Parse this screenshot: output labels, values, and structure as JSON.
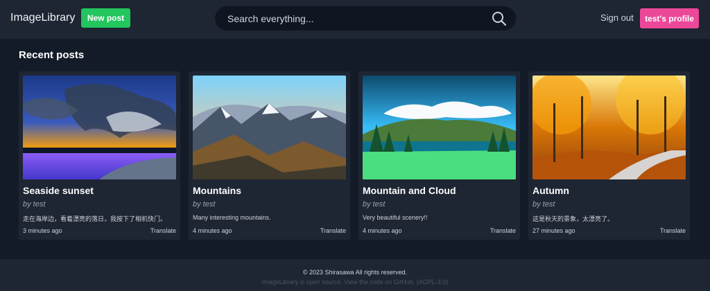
{
  "header": {
    "brand": "ImageLibrary",
    "new_post_label": "New post",
    "search_placeholder": "Search everything...",
    "signout_label": "Sign out",
    "profile_label": "test's profile",
    "colors": {
      "new_post": "#22c55e",
      "profile": "#ec4899"
    }
  },
  "main": {
    "section_title": "Recent posts",
    "posts": [
      {
        "title": "Seaside sunset",
        "author": "by test",
        "description": "走在海岸边，看着漂亮的落日，我按下了相机快门。",
        "time": "3 minutes ago",
        "translate": "Translate"
      },
      {
        "title": "Mountains",
        "author": "by test",
        "description": "Many interesting mountains.",
        "time": "4 minutes ago",
        "translate": "Translate"
      },
      {
        "title": "Mountain and Cloud",
        "author": "by test",
        "description": "Very beautiful scenery!!",
        "time": "4 minutes ago",
        "translate": "Translate"
      },
      {
        "title": "Autumn",
        "author": "by test",
        "description": "这是秋天的景象，太漂亮了。",
        "time": "27 minutes ago",
        "translate": "Translate"
      }
    ]
  },
  "footer": {
    "copyright": "© 2023 Shirasawa All rights reserved.",
    "source": "ImageLibrary is open source. View the code on GitHub. (AGPL-3.0)"
  }
}
